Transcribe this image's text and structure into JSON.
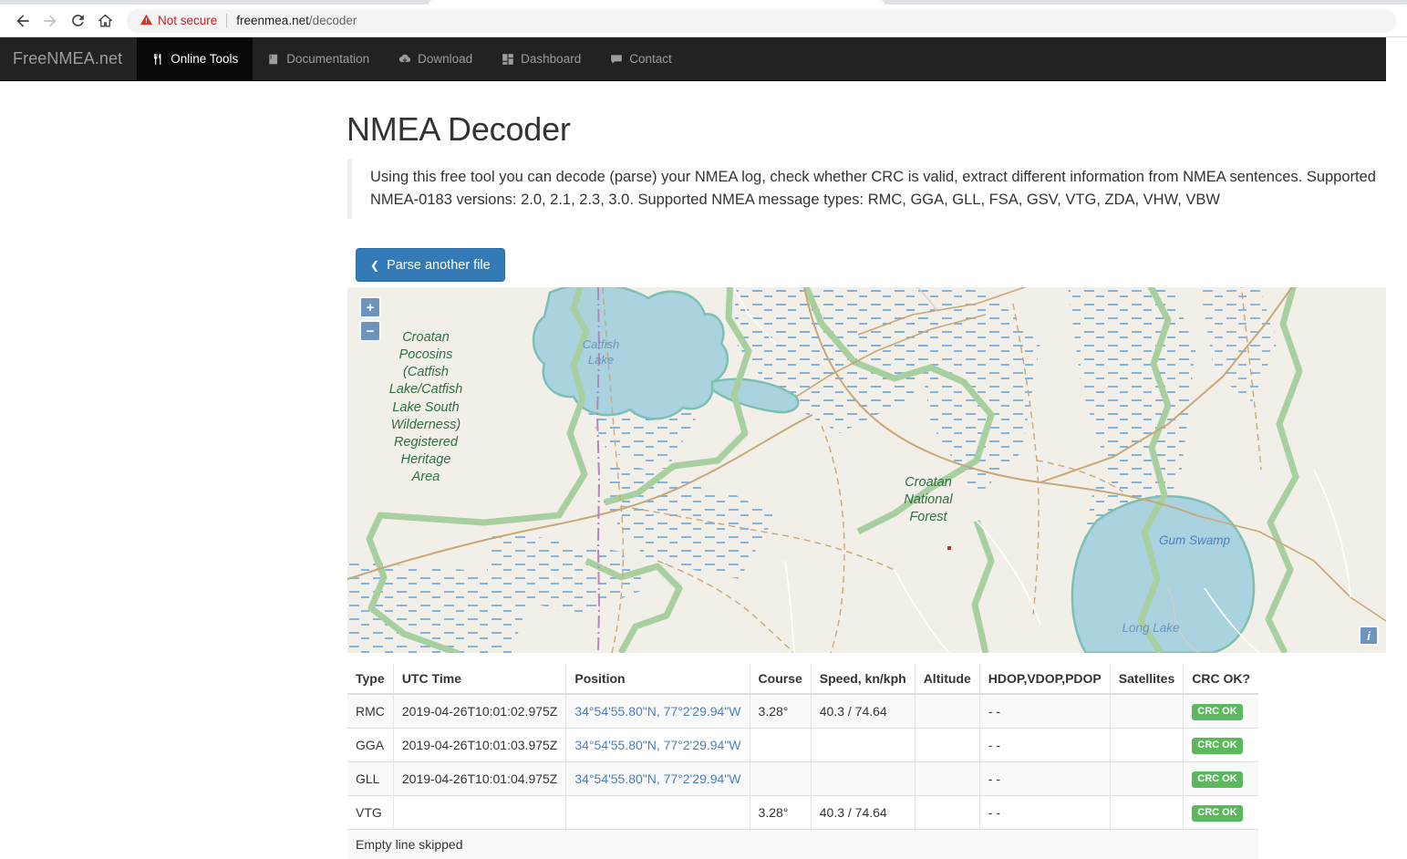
{
  "browser": {
    "back_icon": "back-arrow-icon",
    "forward_icon": "forward-arrow-icon",
    "reload_icon": "reload-icon",
    "home_icon": "home-icon",
    "security_warning": "Not secure",
    "url_host": "freenmea.net",
    "url_path": "/decoder",
    "url_full": "freenmea.net/decoder"
  },
  "navbar": {
    "brand": "FreeNMEA.net",
    "items": [
      {
        "label": "Online Tools",
        "icon": "fork-knife-icon",
        "active": true
      },
      {
        "label": "Documentation",
        "icon": "book-icon",
        "active": false
      },
      {
        "label": "Download",
        "icon": "cloud-download-icon",
        "active": false
      },
      {
        "label": "Dashboard",
        "icon": "grid-dashboard-icon",
        "active": false
      },
      {
        "label": "Contact",
        "icon": "comment-icon",
        "active": false
      }
    ]
  },
  "page": {
    "title": "NMEA Decoder",
    "intro": "Using this free tool you can decode (parse) your NMEA log, check whether CRC is valid, extract different information from NMEA sentences. Supported NMEA-0183 versions: 2.0, 2.1, 2.3, 3.0. Supported NMEA message types: RMC, GGA, GLL, FSA, GSV, VTG, ZDA, VHW, VBW",
    "parse_button": "Parse another file",
    "parse_button_icon": "chevron-left-icon"
  },
  "map": {
    "zoom_in": "+",
    "zoom_out": "−",
    "info": "i",
    "labels": [
      {
        "name": "croatan-pocosins",
        "text": "Croatan\nPocosins\n(Catfish\nLake/Catfish\nLake South\nWilderness)\nRegistered\nHeritage\nArea"
      },
      {
        "name": "catfish-lake",
        "text": "Catfish\nLake"
      },
      {
        "name": "croatan-national-forest",
        "text": "Croatan\nNational\nForest"
      },
      {
        "name": "gum-swamp",
        "text": "Gum Swamp"
      },
      {
        "name": "long-lake",
        "text": "Long Lake"
      }
    ],
    "colors": {
      "land": "#f2efe9",
      "water": "#aad3df",
      "forest_boundary": "#a8cfa0",
      "marker": "#b03a2e",
      "control": "#6e94be"
    }
  },
  "table": {
    "headers": [
      "Type",
      "UTC Time",
      "Position",
      "Course",
      "Speed, kn/kph",
      "Altitude",
      "HDOP,VDOP,PDOP",
      "Satellites",
      "CRC OK?"
    ],
    "rows": [
      {
        "type": "RMC",
        "utc": "2019-04-26T10:01:02.975Z",
        "position": "34°54'55.80\"N, 77°2'29.94\"W",
        "course": "3.28°",
        "speed": "40.3 / 74.64",
        "altitude": "",
        "dop": "- -",
        "satellites": "",
        "crc": "CRC OK"
      },
      {
        "type": "GGA",
        "utc": "2019-04-26T10:01:03.975Z",
        "position": "34°54'55.80\"N, 77°2'29.94\"W",
        "course": "",
        "speed": "",
        "altitude": "",
        "dop": "- -",
        "satellites": "",
        "crc": "CRC OK"
      },
      {
        "type": "GLL",
        "utc": "2019-04-26T10:01:04.975Z",
        "position": "34°54'55.80\"N, 77°2'29.94\"W",
        "course": "",
        "speed": "",
        "altitude": "",
        "dop": "- -",
        "satellites": "",
        "crc": "CRC OK"
      },
      {
        "type": "VTG",
        "utc": "",
        "position": "",
        "course": "3.28°",
        "speed": "40.3 / 74.64",
        "altitude": "",
        "dop": "- -",
        "satellites": "",
        "crc": "CRC OK"
      }
    ],
    "footer_note": "Empty line skipped",
    "crc_badge_color": "#5cb85c",
    "link_color": "#4a7fbb"
  }
}
